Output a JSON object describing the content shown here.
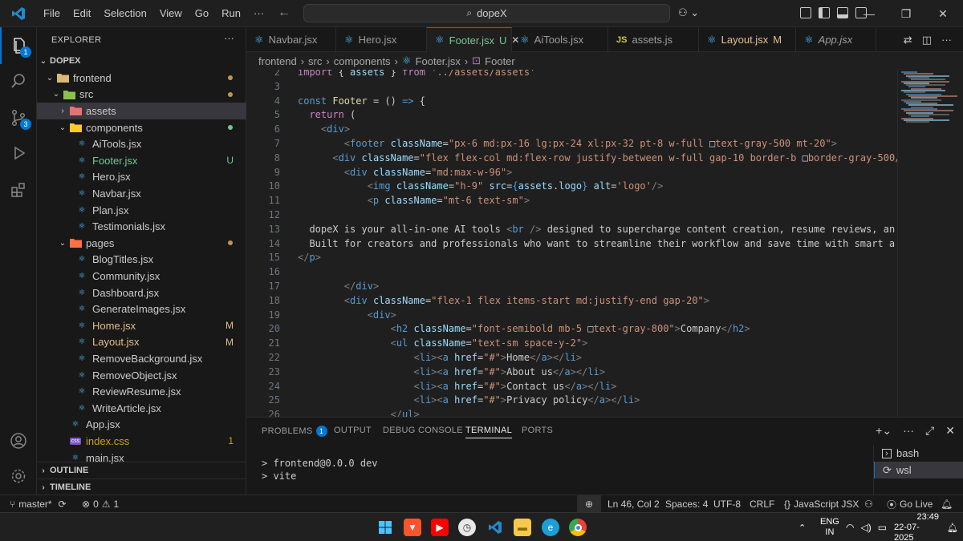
{
  "menu": [
    "File",
    "Edit",
    "Selection",
    "View",
    "Go",
    "Run",
    "···"
  ],
  "search": {
    "text": "dopeX"
  },
  "activity": {
    "explorer_badge": "1",
    "scm_badge": "3"
  },
  "sidebar": {
    "title": "EXPLORER",
    "root": "DOPEX",
    "items": [
      {
        "label": "frontend",
        "indent": 1,
        "chev": "v",
        "kind": "folder",
        "dot": "#c09553"
      },
      {
        "label": "src",
        "indent": 2,
        "chev": "v",
        "kind": "folder-src",
        "dot": "#c09553"
      },
      {
        "label": "assets",
        "indent": 3,
        "chev": ">",
        "kind": "folder-assets",
        "selected": true
      },
      {
        "label": "components",
        "indent": 3,
        "chev": "v",
        "kind": "folder-comp",
        "dot": "#73c991"
      },
      {
        "label": "AiTools.jsx",
        "indent": 4,
        "kind": "react"
      },
      {
        "label": "Footer.jsx",
        "indent": 4,
        "kind": "react",
        "status": "U",
        "status_color": "#73c991"
      },
      {
        "label": "Hero.jsx",
        "indent": 4,
        "kind": "react"
      },
      {
        "label": "Navbar.jsx",
        "indent": 4,
        "kind": "react"
      },
      {
        "label": "Plan.jsx",
        "indent": 4,
        "kind": "react"
      },
      {
        "label": "Testimonials.jsx",
        "indent": 4,
        "kind": "react"
      },
      {
        "label": "pages",
        "indent": 3,
        "chev": "v",
        "kind": "folder-pages",
        "dot": "#c09553"
      },
      {
        "label": "BlogTitles.jsx",
        "indent": 4,
        "kind": "react"
      },
      {
        "label": "Community.jsx",
        "indent": 4,
        "kind": "react"
      },
      {
        "label": "Dashboard.jsx",
        "indent": 4,
        "kind": "react"
      },
      {
        "label": "GenerateImages.jsx",
        "indent": 4,
        "kind": "react"
      },
      {
        "label": "Home.jsx",
        "indent": 4,
        "kind": "react",
        "status": "M",
        "status_color": "#e2c08d",
        "color": "#e2c08d"
      },
      {
        "label": "Layout.jsx",
        "indent": 4,
        "kind": "react",
        "status": "M",
        "status_color": "#e2c08d",
        "color": "#e2c08d"
      },
      {
        "label": "RemoveBackground.jsx",
        "indent": 4,
        "kind": "react"
      },
      {
        "label": "RemoveObject.jsx",
        "indent": 4,
        "kind": "react"
      },
      {
        "label": "ReviewResume.jsx",
        "indent": 4,
        "kind": "react"
      },
      {
        "label": "WriteArticle.jsx",
        "indent": 4,
        "kind": "react"
      },
      {
        "label": "App.jsx",
        "indent": 3,
        "kind": "react"
      },
      {
        "label": "index.css",
        "indent": 3,
        "kind": "css",
        "status": "1",
        "status_color": "#cca700",
        "color": "#cca700"
      },
      {
        "label": "main.jsx",
        "indent": 3,
        "kind": "react"
      }
    ],
    "outline": "OUTLINE",
    "timeline": "TIMELINE"
  },
  "tabs": [
    {
      "label": "Navbar.jsx",
      "icon": "react"
    },
    {
      "label": "Hero.jsx",
      "icon": "react"
    },
    {
      "label": "Footer.jsx",
      "icon": "react",
      "suffix": "U",
      "active": true,
      "suffix_color": "#73c991",
      "label_color": "#73c991"
    },
    {
      "label": "AiTools.jsx",
      "icon": "react"
    },
    {
      "label": "assets.js",
      "icon": "js"
    },
    {
      "label": "Layout.jsx",
      "icon": "react",
      "suffix": "M",
      "suffix_color": "#e2c08d",
      "label_color": "#e2c08d"
    },
    {
      "label": "App.jsx",
      "icon": "react",
      "italic": true
    }
  ],
  "breadcrumb": [
    "frontend",
    "src",
    "components",
    "Footer.jsx",
    "Footer"
  ],
  "code": [
    {
      "n": "2",
      "tokens": [
        [
          "import",
          "#c586c0"
        ],
        [
          " { ",
          "#cccccc"
        ],
        [
          "assets",
          "#9cdcfe"
        ],
        [
          " } ",
          "#cccccc"
        ],
        [
          "from",
          "#c586c0"
        ],
        [
          " ",
          "#cccccc"
        ],
        [
          "'../assets/assets'",
          "#ce9178"
        ]
      ]
    },
    {
      "n": "3",
      "tokens": []
    },
    {
      "n": "4",
      "tokens": [
        [
          "const",
          "#569cd6"
        ],
        [
          " ",
          "#cccccc"
        ],
        [
          "Footer",
          "#dcdcaa"
        ],
        [
          " = () ",
          "#cccccc"
        ],
        [
          "=>",
          "#569cd6"
        ],
        [
          " {",
          "#cccccc"
        ]
      ]
    },
    {
      "n": "5",
      "tokens": [
        [
          "  return",
          "#c586c0"
        ],
        [
          " (",
          "#cccccc"
        ]
      ]
    },
    {
      "n": "6",
      "tokens": [
        [
          "    <",
          "#808080"
        ],
        [
          "div",
          "#569cd6"
        ],
        [
          ">",
          "#808080"
        ]
      ]
    },
    {
      "n": "7",
      "tokens": [
        [
          "        <",
          "#808080"
        ],
        [
          "footer",
          "#569cd6"
        ],
        [
          " ",
          "#cccccc"
        ],
        [
          "className",
          "#9cdcfe"
        ],
        [
          "=",
          "#cccccc"
        ],
        [
          "\"px-6 md:px-16 lg:px-24 xl:px-32 pt-8 w-full ",
          "#ce9178"
        ],
        [
          "□",
          "#cccccc"
        ],
        [
          "text-gray-500 mt-20\"",
          "#ce9178"
        ],
        [
          ">",
          "#808080"
        ]
      ]
    },
    {
      "n": "8",
      "tokens": [
        [
          "      <",
          "#808080"
        ],
        [
          "div",
          "#569cd6"
        ],
        [
          " ",
          "#cccccc"
        ],
        [
          "className",
          "#9cdcfe"
        ],
        [
          "=",
          "#cccccc"
        ],
        [
          "\"flex flex-col md:flex-row justify-between w-full gap-10 border-b ",
          "#ce9178"
        ],
        [
          "□",
          "#cccccc"
        ],
        [
          "border-gray-500/",
          "#ce9178"
        ]
      ]
    },
    {
      "n": "9",
      "tokens": [
        [
          "        <",
          "#808080"
        ],
        [
          "div",
          "#569cd6"
        ],
        [
          " ",
          "#cccccc"
        ],
        [
          "className",
          "#9cdcfe"
        ],
        [
          "=",
          "#cccccc"
        ],
        [
          "\"md:max-w-96\"",
          "#ce9178"
        ],
        [
          ">",
          "#808080"
        ]
      ]
    },
    {
      "n": "10",
      "tokens": [
        [
          "            <",
          "#808080"
        ],
        [
          "img",
          "#569cd6"
        ],
        [
          " ",
          "#cccccc"
        ],
        [
          "className",
          "#9cdcfe"
        ],
        [
          "=",
          "#cccccc"
        ],
        [
          "\"h-9\"",
          "#ce9178"
        ],
        [
          " ",
          "#cccccc"
        ],
        [
          "src",
          "#9cdcfe"
        ],
        [
          "=",
          "#cccccc"
        ],
        [
          "{",
          "#569cd6"
        ],
        [
          "assets",
          "#9cdcfe"
        ],
        [
          ".",
          "#cccccc"
        ],
        [
          "logo",
          "#9cdcfe"
        ],
        [
          "}",
          "#569cd6"
        ],
        [
          " ",
          "#cccccc"
        ],
        [
          "alt",
          "#9cdcfe"
        ],
        [
          "=",
          "#cccccc"
        ],
        [
          "'logo'",
          "#ce9178"
        ],
        [
          "/>",
          "#808080"
        ]
      ]
    },
    {
      "n": "11",
      "tokens": [
        [
          "            <",
          "#808080"
        ],
        [
          "p",
          "#569cd6"
        ],
        [
          " ",
          "#cccccc"
        ],
        [
          "className",
          "#9cdcfe"
        ],
        [
          "=",
          "#cccccc"
        ],
        [
          "\"mt-6 text-sm\"",
          "#ce9178"
        ],
        [
          ">",
          "#808080"
        ]
      ]
    },
    {
      "n": "12",
      "tokens": []
    },
    {
      "n": "13",
      "tokens": [
        [
          "  dopeX is your all-in-one AI tools ",
          "#cccccc"
        ],
        [
          "<",
          "#808080"
        ],
        [
          "br",
          "#569cd6"
        ],
        [
          " />",
          "#808080"
        ],
        [
          " designed to supercharge content creation, resume reviews, an",
          "#cccccc"
        ]
      ]
    },
    {
      "n": "14",
      "tokens": [
        [
          "  Built for creators and professionals who want to streamline their workflow and save time with smart a",
          "#cccccc"
        ]
      ]
    },
    {
      "n": "15",
      "tokens": [
        [
          "</",
          "#808080"
        ],
        [
          "p",
          "#569cd6"
        ],
        [
          ">",
          "#808080"
        ]
      ]
    },
    {
      "n": "16",
      "tokens": []
    },
    {
      "n": "17",
      "tokens": [
        [
          "        </",
          "#808080"
        ],
        [
          "div",
          "#569cd6"
        ],
        [
          ">",
          "#808080"
        ]
      ]
    },
    {
      "n": "18",
      "tokens": [
        [
          "        <",
          "#808080"
        ],
        [
          "div",
          "#569cd6"
        ],
        [
          " ",
          "#cccccc"
        ],
        [
          "className",
          "#9cdcfe"
        ],
        [
          "=",
          "#cccccc"
        ],
        [
          "\"flex-1 flex items-start md:justify-end gap-20\"",
          "#ce9178"
        ],
        [
          ">",
          "#808080"
        ]
      ]
    },
    {
      "n": "19",
      "tokens": [
        [
          "            <",
          "#808080"
        ],
        [
          "div",
          "#569cd6"
        ],
        [
          ">",
          "#808080"
        ]
      ]
    },
    {
      "n": "20",
      "tokens": [
        [
          "                <",
          "#808080"
        ],
        [
          "h2",
          "#569cd6"
        ],
        [
          " ",
          "#cccccc"
        ],
        [
          "className",
          "#9cdcfe"
        ],
        [
          "=",
          "#cccccc"
        ],
        [
          "\"font-semibold mb-5 ",
          "#ce9178"
        ],
        [
          "□",
          "#cccccc"
        ],
        [
          "text-gray-800\"",
          "#ce9178"
        ],
        [
          ">",
          "#808080"
        ],
        [
          "Company",
          "#cccccc"
        ],
        [
          "</",
          "#808080"
        ],
        [
          "h2",
          "#569cd6"
        ],
        [
          ">",
          "#808080"
        ]
      ]
    },
    {
      "n": "21",
      "tokens": [
        [
          "                <",
          "#808080"
        ],
        [
          "ul",
          "#569cd6"
        ],
        [
          " ",
          "#cccccc"
        ],
        [
          "className",
          "#9cdcfe"
        ],
        [
          "=",
          "#cccccc"
        ],
        [
          "\"text-sm space-y-2\"",
          "#ce9178"
        ],
        [
          ">",
          "#808080"
        ]
      ]
    },
    {
      "n": "22",
      "tokens": [
        [
          "                    <",
          "#808080"
        ],
        [
          "li",
          "#569cd6"
        ],
        [
          "><",
          "#808080"
        ],
        [
          "a",
          "#569cd6"
        ],
        [
          " ",
          "#cccccc"
        ],
        [
          "href",
          "#9cdcfe"
        ],
        [
          "=",
          "#cccccc"
        ],
        [
          "\"#\"",
          "#ce9178"
        ],
        [
          ">",
          "#808080"
        ],
        [
          "Home",
          "#cccccc"
        ],
        [
          "</",
          "#808080"
        ],
        [
          "a",
          "#569cd6"
        ],
        [
          "></",
          "#808080"
        ],
        [
          "li",
          "#569cd6"
        ],
        [
          ">",
          "#808080"
        ]
      ]
    },
    {
      "n": "23",
      "tokens": [
        [
          "                    <",
          "#808080"
        ],
        [
          "li",
          "#569cd6"
        ],
        [
          "><",
          "#808080"
        ],
        [
          "a",
          "#569cd6"
        ],
        [
          " ",
          "#cccccc"
        ],
        [
          "href",
          "#9cdcfe"
        ],
        [
          "=",
          "#cccccc"
        ],
        [
          "\"#\"",
          "#ce9178"
        ],
        [
          ">",
          "#808080"
        ],
        [
          "About us",
          "#cccccc"
        ],
        [
          "</",
          "#808080"
        ],
        [
          "a",
          "#569cd6"
        ],
        [
          "></",
          "#808080"
        ],
        [
          "li",
          "#569cd6"
        ],
        [
          ">",
          "#808080"
        ]
      ]
    },
    {
      "n": "24",
      "tokens": [
        [
          "                    <",
          "#808080"
        ],
        [
          "li",
          "#569cd6"
        ],
        [
          "><",
          "#808080"
        ],
        [
          "a",
          "#569cd6"
        ],
        [
          " ",
          "#cccccc"
        ],
        [
          "href",
          "#9cdcfe"
        ],
        [
          "=",
          "#cccccc"
        ],
        [
          "\"#\"",
          "#ce9178"
        ],
        [
          ">",
          "#808080"
        ],
        [
          "Contact us",
          "#cccccc"
        ],
        [
          "</",
          "#808080"
        ],
        [
          "a",
          "#569cd6"
        ],
        [
          "></",
          "#808080"
        ],
        [
          "li",
          "#569cd6"
        ],
        [
          ">",
          "#808080"
        ]
      ]
    },
    {
      "n": "25",
      "tokens": [
        [
          "                    <",
          "#808080"
        ],
        [
          "li",
          "#569cd6"
        ],
        [
          "><",
          "#808080"
        ],
        [
          "a",
          "#569cd6"
        ],
        [
          " ",
          "#cccccc"
        ],
        [
          "href",
          "#9cdcfe"
        ],
        [
          "=",
          "#cccccc"
        ],
        [
          "\"#\"",
          "#ce9178"
        ],
        [
          ">",
          "#808080"
        ],
        [
          "Privacy policy",
          "#cccccc"
        ],
        [
          "</",
          "#808080"
        ],
        [
          "a",
          "#569cd6"
        ],
        [
          "></",
          "#808080"
        ],
        [
          "li",
          "#569cd6"
        ],
        [
          ">",
          "#808080"
        ]
      ]
    },
    {
      "n": "26",
      "tokens": [
        [
          "                </",
          "#808080"
        ],
        [
          "ul",
          "#569cd6"
        ],
        [
          ">",
          "#808080"
        ]
      ]
    }
  ],
  "panel": {
    "tabs": [
      "PROBLEMS",
      "OUTPUT",
      "DEBUG CONSOLE",
      "TERMINAL",
      "PORTS"
    ],
    "problems_badge": "1",
    "active_tab": "TERMINAL",
    "terminal_lines": [
      "> frontend@0.0.0 dev",
      "> vite"
    ],
    "terminals": [
      "bash",
      "wsl"
    ],
    "selected_terminal": "wsl"
  },
  "status": {
    "branch": "master*",
    "errors": "0",
    "warnings": "1",
    "position": "Ln 46, Col 2",
    "spaces": "Spaces: 4",
    "encoding": "UTF-8",
    "eol": "CRLF",
    "language": "JavaScript JSX",
    "golive": "Go Live"
  },
  "taskbar": {
    "lang": "ENG",
    "region": "IN",
    "time": "23:49",
    "date": "22-07-2025"
  },
  "colors": {
    "accent": "#0078d4",
    "modified": "#e2c08d",
    "untracked": "#73c991"
  }
}
